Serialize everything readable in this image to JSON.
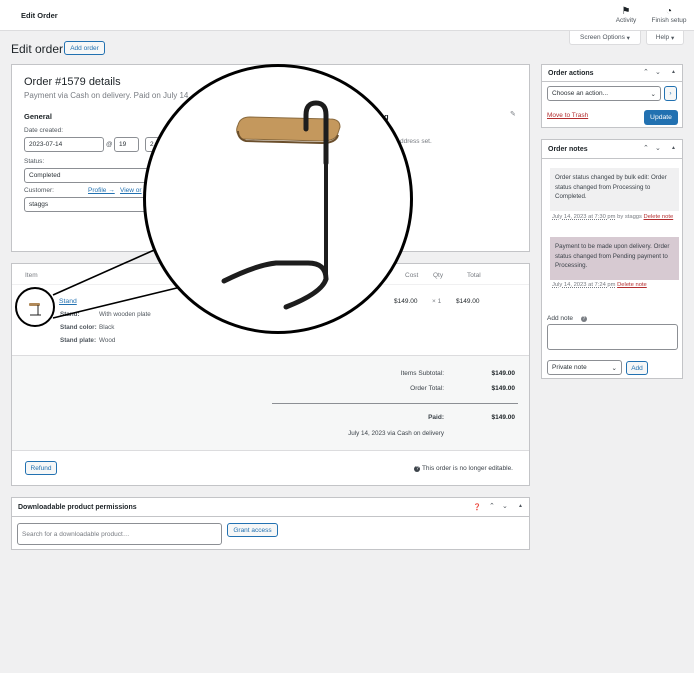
{
  "topbar": {
    "title": "Edit Order",
    "activity": "Activity",
    "finish_setup": "Finish setup"
  },
  "header": {
    "page_title": "Edit order",
    "add_order": "Add order",
    "screen_options": "Screen Options",
    "help": "Help"
  },
  "order": {
    "title": "Order #1579 details",
    "subtitle": "Payment via Cash on delivery. Paid on July 14,",
    "general": "General",
    "billing_hint": "g",
    "address_hint": "ddress set.",
    "date_label": "Date created:",
    "date": "2023-07-14",
    "at": "@",
    "hour": "19",
    "minute": "2",
    "status_label": "Status:",
    "status": "Completed",
    "customer_label": "Customer:",
    "profile_link": "Profile →",
    "view_link": "View or",
    "customer": "staggs"
  },
  "items": {
    "head_item": "Item",
    "head_cost": "Cost",
    "head_qty": "Qty",
    "head_total": "Total",
    "name": "Stand",
    "cost": "$149.00",
    "qty": "× 1",
    "total": "$149.00",
    "meta": [
      {
        "key": "Stand:",
        "value": "With wooden plate"
      },
      {
        "key": "Stand color:",
        "value": "Black"
      },
      {
        "key": "Stand plate:",
        "value": "Wood"
      }
    ],
    "subtotal_label": "Items Subtotal:",
    "subtotal": "$149.00",
    "order_total_label": "Order Total:",
    "order_total": "$149.00",
    "paid_label": "Paid:",
    "paid": "$149.00",
    "paid_note": "July 14, 2023 via Cash on delivery",
    "refund": "Refund",
    "not_editable": "This order is no longer editable."
  },
  "downloads": {
    "title": "Downloadable product permissions",
    "search_placeholder": "Search for a downloadable product…",
    "grant": "Grant access"
  },
  "actions": {
    "title": "Order actions",
    "select": "Choose an action...",
    "go": "›",
    "trash": "Move to Trash",
    "update": "Update"
  },
  "notes": {
    "title": "Order notes",
    "list": [
      {
        "text": "Order status changed by bulk edit: Order status changed from Processing to Completed.",
        "date": "July 14, 2023 at 7:30 pm",
        "by": " by staggs ",
        "delete": "Delete note"
      },
      {
        "text": "Payment to be made upon delivery. Order status changed from Pending payment to Processing.",
        "date": "July 14, 2023 at 7:24 pm",
        "delete": "Delete note"
      }
    ],
    "add_label": "Add note",
    "note_type": "Private note",
    "add_button": "Add"
  },
  "colors": {
    "accent": "#2271b1",
    "danger": "#b32d2e",
    "customer_note": "#d7cad2",
    "system_note": "#f0f0f1"
  },
  "icons": [
    "flag-icon",
    "half-circle-icon",
    "help-icon",
    "chevron-up-icon",
    "chevron-down-icon",
    "toggle-arrow-icon",
    "pencil-icon",
    "product-thumbnail"
  ]
}
